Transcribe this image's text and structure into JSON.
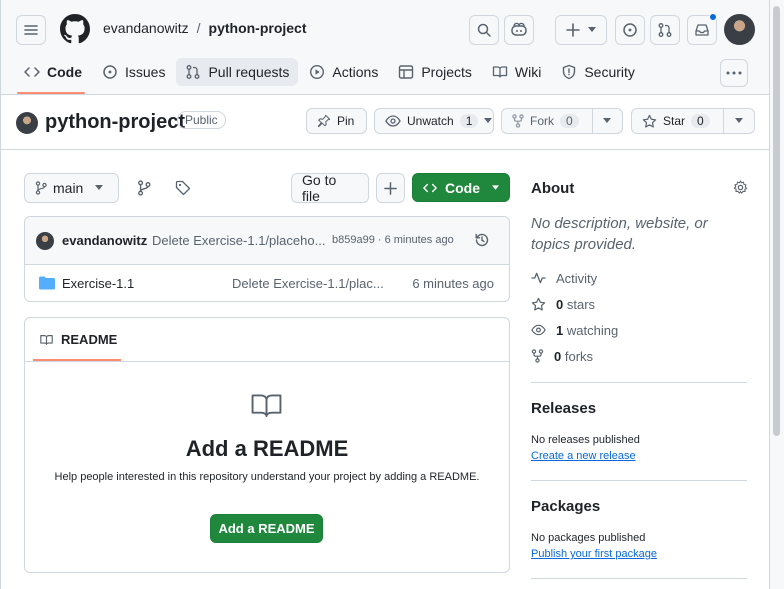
{
  "header": {
    "owner": "evandanowitz",
    "separator": "/",
    "repo": "python-project"
  },
  "tabs": [
    {
      "label": "Code",
      "icon": "code-icon"
    },
    {
      "label": "Issues",
      "icon": "issue-icon"
    },
    {
      "label": "Pull requests",
      "icon": "pull-request-icon"
    },
    {
      "label": "Actions",
      "icon": "play-icon"
    },
    {
      "label": "Projects",
      "icon": "table-icon"
    },
    {
      "label": "Wiki",
      "icon": "book-icon"
    },
    {
      "label": "Security",
      "icon": "shield-icon"
    }
  ],
  "repobar": {
    "title": "python-project",
    "visibility": "Public",
    "pin": "Pin",
    "unwatch": "Unwatch",
    "watch_count": "1",
    "fork": "Fork",
    "fork_count": "0",
    "star": "Star",
    "star_count": "0"
  },
  "toolbar": {
    "branch": "main",
    "go_to_file": "Go to file",
    "code": "Code"
  },
  "commit": {
    "author": "evandanowitz",
    "message": "Delete Exercise-1.1/placeho...",
    "meta": "b859a99 · 6 minutes ago"
  },
  "files": [
    {
      "name": "Exercise-1.1",
      "message": "Delete Exercise-1.1/plac...",
      "time": "6 minutes ago"
    }
  ],
  "readme": {
    "tab": "README",
    "title": "Add a README",
    "description": "Help people interested in this repository understand your project by adding a README.",
    "button": "Add a README"
  },
  "about": {
    "heading": "About",
    "description": "No description, website, or topics provided.",
    "activity": "Activity",
    "stars_count": "0",
    "stars_label": "stars",
    "watching_count": "1",
    "watching_label": "watching",
    "forks_count": "0",
    "forks_label": "forks"
  },
  "releases": {
    "heading": "Releases",
    "none": "No releases published",
    "link": "Create a new release"
  },
  "packages": {
    "heading": "Packages",
    "none": "No packages published",
    "link": "Publish your first package"
  },
  "colors": {
    "primary_green": "#1f883d",
    "link_blue": "#0969da",
    "tab_underline": "#fd8c73",
    "folder_blue": "#54aeff"
  }
}
